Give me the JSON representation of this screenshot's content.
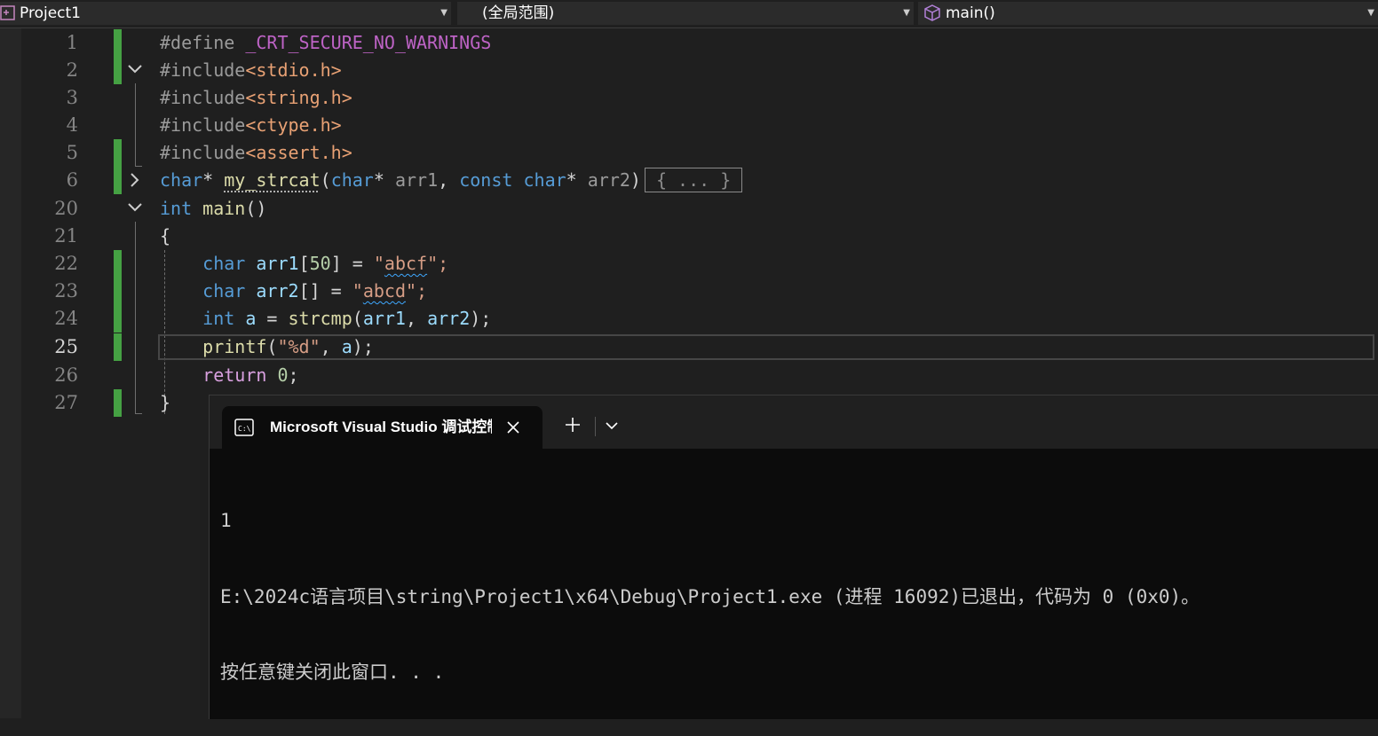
{
  "navbar": {
    "project": "Project1",
    "scope": "(全局范围)",
    "function": "main()"
  },
  "line_numbers": [
    "1",
    "2",
    "3",
    "4",
    "5",
    "6",
    "20",
    "21",
    "22",
    "23",
    "24",
    "25",
    "26",
    "27"
  ],
  "code": {
    "l1": {
      "directive": "#define",
      "macro": "_CRT_SECURE_NO_WARNINGS"
    },
    "l2": {
      "directive": "#include",
      "header": "<stdio.h>"
    },
    "l3": {
      "directive": "#include",
      "header": "<string.h>"
    },
    "l4": {
      "directive": "#include",
      "header": "<ctype.h>"
    },
    "l5": {
      "directive": "#include",
      "header": "<assert.h>"
    },
    "l6": {
      "t1": "char",
      "t2": "* ",
      "t3": "my_strcat",
      "t4": "(",
      "t5": "char",
      "t6": "* ",
      "t7": "arr1",
      "t8": ", ",
      "t9": "const",
      "t10": " ",
      "t11": "char",
      "t12": "* ",
      "t13": "arr2",
      "t14": ")",
      "collapsed": "{ ... }"
    },
    "l20": {
      "t1": "int",
      "t2": " ",
      "t3": "main",
      "t4": "()"
    },
    "l21": {
      "t1": "{"
    },
    "l22": {
      "t1": "    ",
      "t2": "char",
      "t3": " ",
      "t4": "arr1",
      "t5": "[",
      "t6": "50",
      "t7": "] = ",
      "t8": "\"",
      "t9": "abcf",
      "t10": "\";"
    },
    "l23": {
      "t1": "    ",
      "t2": "char",
      "t3": " ",
      "t4": "arr2",
      "t5": "[] = ",
      "t6": "\"",
      "t7": "abcd",
      "t8": "\";"
    },
    "l24": {
      "t1": "    ",
      "t2": "int",
      "t3": " ",
      "t4": "a",
      "t5": " = ",
      "t6": "strcmp",
      "t7": "(",
      "t8": "arr1",
      "t9": ", ",
      "t10": "arr2",
      "t11": ");"
    },
    "l25": {
      "t1": "    ",
      "t2": "printf",
      "t3": "(",
      "t4": "\"%d\"",
      "t5": ", ",
      "t6": "a",
      "t7": ");"
    },
    "l26": {
      "t1": "    ",
      "t2": "return",
      "t3": " ",
      "t4": "0",
      "t5": ";"
    },
    "l27": {
      "t1": "}"
    }
  },
  "terminal": {
    "tab_title": "Microsoft Visual Studio 调试控制台",
    "output": [
      "1",
      "E:\\2024c语言项目\\string\\Project1\\x64\\Debug\\Project1.exe (进程 16092)已退出，代码为 0 (0x0)。",
      "按任意键关闭此窗口. . ."
    ]
  },
  "colors": {
    "keyword": "#569cd6",
    "function": "#dcdcaa",
    "string": "#d69d85",
    "change_marker": "#45a143",
    "terminal_bg": "#0c0c0c"
  },
  "icons": [
    "project-icon",
    "cube-icon",
    "terminal-icon",
    "close-icon",
    "plus-icon",
    "chevron-down-icon",
    "chevron-right-icon"
  ]
}
